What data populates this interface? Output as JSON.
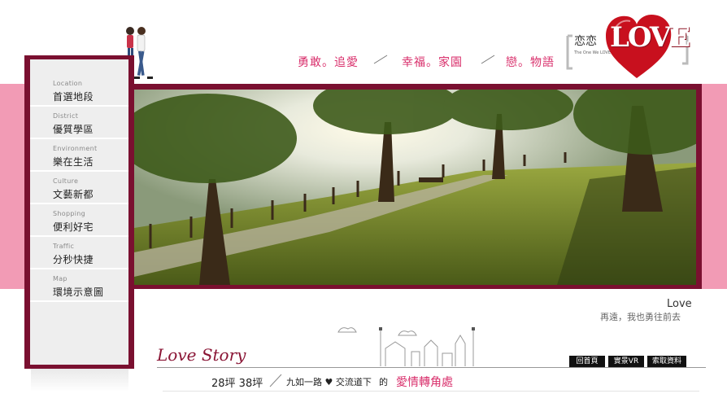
{
  "colors": {
    "accent": "#7a1030",
    "pink": "#f29bb5",
    "slogan": "#d9306c"
  },
  "header": {
    "slogan": [
      "勇敢。追愛",
      "幸福。家園",
      "戀。物語"
    ]
  },
  "logo": {
    "cn": "恋恋",
    "word": "LOVE",
    "small": "The One We LOVE"
  },
  "sidebar": {
    "items": [
      {
        "en": "Location",
        "zh": "首選地段"
      },
      {
        "en": "District",
        "zh": "優質學區"
      },
      {
        "en": "Environment",
        "zh": "樂在生活"
      },
      {
        "en": "Culture",
        "zh": "文藝新都"
      },
      {
        "en": "Shopping",
        "zh": "便利好宅"
      },
      {
        "en": "Traffic",
        "zh": "分秒快捷"
      },
      {
        "en": "Map",
        "zh": "環境示意圖"
      }
    ]
  },
  "tagline": {
    "title": "Love",
    "sub": "再遠，我也勇往前去"
  },
  "footer": {
    "love_story": "Love Story",
    "buttons": [
      "回首頁",
      "實景VR",
      "索取資料"
    ],
    "size": "28坪 38坪",
    "route": "九如一路 ♥ 交流道下",
    "of": "的",
    "corner": "愛情轉角處"
  }
}
